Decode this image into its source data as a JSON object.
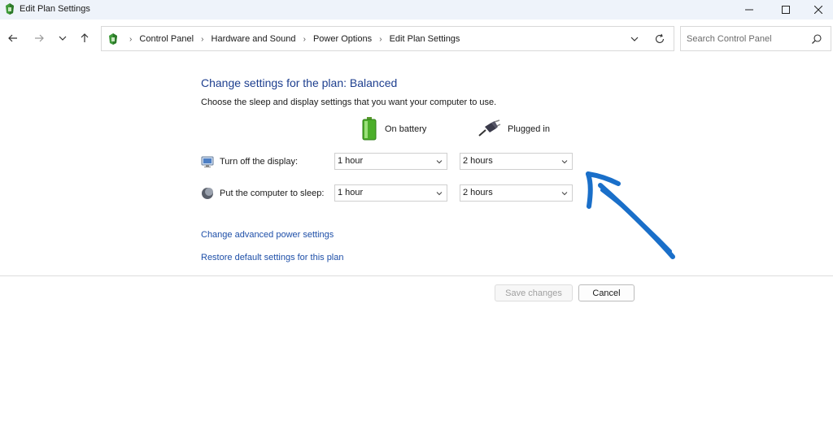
{
  "window": {
    "title": "Edit Plan Settings"
  },
  "navigation": {
    "breadcrumbs": [
      "Control Panel",
      "Hardware and Sound",
      "Power Options",
      "Edit Plan Settings"
    ],
    "search_placeholder": "Search Control Panel"
  },
  "main": {
    "title": "Change settings for the plan: Balanced",
    "description": "Choose the sleep and display settings that you want your computer to use.",
    "columns": {
      "battery": "On battery",
      "plugged": "Plugged in"
    },
    "rows": [
      {
        "label": "Turn off the display:",
        "on_battery": "1 hour",
        "plugged_in": "2 hours"
      },
      {
        "label": "Put the computer to sleep:",
        "on_battery": "1 hour",
        "plugged_in": "2 hours"
      }
    ],
    "links": {
      "advanced": "Change advanced power settings",
      "restore": "Restore default settings for this plan"
    }
  },
  "footer": {
    "save_label": "Save changes",
    "cancel_label": "Cancel"
  },
  "colors": {
    "title_blue": "#1e3f8f",
    "link_blue": "#1e4fa8",
    "annotation_arrow": "#1a6fc9",
    "titlebar_bg": "#eef3fa"
  },
  "icons": {
    "app": "power-options-icon",
    "battery": "battery-icon",
    "plug": "power-plug-icon",
    "display": "monitor-icon",
    "sleep": "sleep-moon-icon"
  }
}
